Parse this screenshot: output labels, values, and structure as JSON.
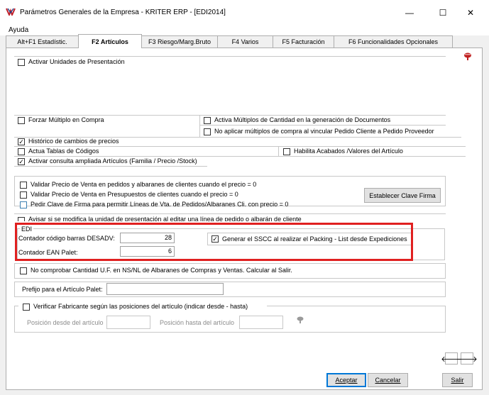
{
  "window": {
    "title": "Parámetros Generales de la Empresa - KRITER ERP - [EDI2014]",
    "minimize": "—",
    "maximize": "☐",
    "close": "✕"
  },
  "menu": {
    "items": [
      "Ayuda"
    ]
  },
  "tabs": [
    {
      "label": "Alt+F1 Estadístic.",
      "active": false
    },
    {
      "label": "F2 Artículos",
      "active": true
    },
    {
      "label": "F3 Riesgo/Marg.Bruto",
      "active": false
    },
    {
      "label": "F4 Varios",
      "active": false
    },
    {
      "label": "F5 Facturación",
      "active": false
    },
    {
      "label": "F6 Funcionalidades Opcionales",
      "active": false
    }
  ],
  "options": {
    "activar_unidades": {
      "label": "Activar Unidades de Presentación",
      "checked": false
    },
    "forzar_multiplo": {
      "label": "Forzar Múltiplo en Compra",
      "checked": false
    },
    "activa_multiplos": {
      "label": "Activa Múltiplos de Cantidad en la generación de  Documentos",
      "checked": false
    },
    "no_aplicar_multiplos": {
      "label": "No aplicar múltiplos de compra al vincular Pedido Cliente a Pedido Proveedor",
      "checked": false
    },
    "historico": {
      "label": "Histórico de cambios de precios",
      "checked": true
    },
    "actua_tablas": {
      "label": "Actua Tablas de Códigos",
      "checked": false
    },
    "habilita_acabados": {
      "label": "Habilita Acabados /Valores del Artículo",
      "checked": false
    },
    "consulta_ampliada": {
      "label": "Activar consulta ampliada Artículos (Familia / Precio /Stock)",
      "checked": true
    },
    "validar_pedidos": {
      "label": "Validar Precio de Venta en pedidos y albaranes de clientes cuando el precio = 0",
      "checked": false
    },
    "validar_presupuestos": {
      "label": "Validar Precio de Venta en Presupuestos de clientes cuando el precio = 0",
      "checked": false
    },
    "pedir_clave": {
      "label": "Pedir Clave de Firma para permitir Líneas de Vta. de Pedidos/Albaranes Cli. con precio = 0",
      "checked": false
    },
    "avisar": {
      "label": "Avisar si se modifica la unidad de presentación al editar una línea de pedido o albarán de cliente",
      "checked": false
    },
    "no_comprobar": {
      "label": "No comprobar Cantidad U.F. en NS/NL de Albaranes de Compras y Ventas. Calcular al Salir.",
      "checked": false
    },
    "verificar_fabricante": {
      "label": "Verificar Fabricante según las posiciones del artículo (indicar desde - hasta)",
      "checked": false
    }
  },
  "establecer_clave": "Establecer Clave Firma",
  "edi": {
    "legend": "EDI",
    "contador_desadv_label": "Contador código barras DESADV:",
    "contador_desadv_value": "28",
    "contador_ean_label": "Contador EAN Palet:",
    "contador_ean_value": "6",
    "generar_sscc": {
      "label": "Generar el SSCC al realizar el Packing - List desde Expediciones",
      "checked": true
    }
  },
  "prefijo_label": "Prefijo para el Artículo Palet:",
  "prefijo_value": "",
  "posicion_desde_label": "Posición desde del artículo",
  "posicion_hasta_label": "Posición hasta del artículo",
  "nav": {
    "prev": "🡐",
    "next": "🡒"
  },
  "buttons": {
    "aceptar": "Aceptar",
    "cancelar": "Cancelar",
    "salir": "Salir"
  },
  "colors": {
    "highlight": "#e02020",
    "accent": "#0078d7"
  }
}
